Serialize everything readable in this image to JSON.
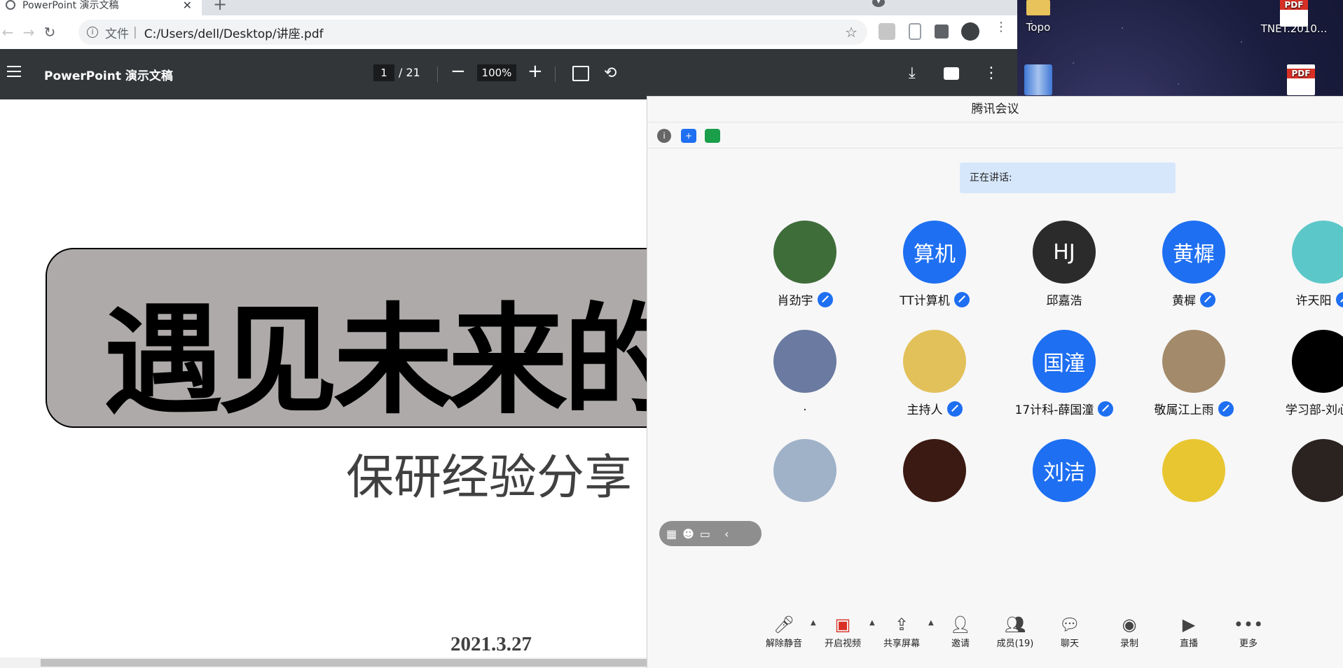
{
  "browser": {
    "tab_title": "PowerPoint 演示文稿",
    "url_label": "文件",
    "url_separator": "|",
    "url": "C:/Users/dell/Desktop/讲座.pdf"
  },
  "pdf_toolbar": {
    "doc_title": "PowerPoint 演示文稿",
    "current_page": "1",
    "total_pages": "/ 21",
    "zoom": "100%"
  },
  "slide": {
    "title": "遇见未来的",
    "subtitle": "保研经验分享",
    "date": "2021.3.27"
  },
  "desktop": {
    "icons": [
      {
        "label": "Topo"
      },
      {
        "label": "TNET.2010...",
        "badge": "PDF"
      },
      {
        "label": "",
        "badge": "PDF"
      }
    ]
  },
  "meeting": {
    "title": "腾讯会议",
    "speaking_label": "正在讲话:",
    "participants": [
      {
        "name": "肖劲宇",
        "avatar_text": "",
        "color": "#3f6d3a",
        "muted": true
      },
      {
        "name": "TT计算机",
        "avatar_text": "算机",
        "color": "#1e6ff1",
        "muted": true
      },
      {
        "name": "邱嘉浩",
        "avatar_text": "HJ",
        "color": "#2b2b2b",
        "muted": false
      },
      {
        "name": "黄樨",
        "avatar_text": "黄樨",
        "color": "#1e6ff1",
        "muted": true
      },
      {
        "name": "许天阳",
        "avatar_text": "",
        "color": "#5cc7c8",
        "muted": true
      },
      {
        "name": ".",
        "avatar_text": "",
        "color": "#6a7aa0",
        "muted": false
      },
      {
        "name": "主持人",
        "avatar_text": "",
        "color": "#e2c15a",
        "muted": true
      },
      {
        "name": "17计科-薛国潼",
        "avatar_text": "国潼",
        "color": "#1e6ff1",
        "muted": true
      },
      {
        "name": "敬属江上雨",
        "avatar_text": "",
        "color": "#a38a6a",
        "muted": true
      },
      {
        "name": "学习部-刘心雨",
        "avatar_text": "",
        "color": "#000000",
        "muted": false
      },
      {
        "name": "",
        "avatar_text": "",
        "color": "#9fb2c8",
        "muted": false
      },
      {
        "name": "",
        "avatar_text": "",
        "color": "#3a1a12",
        "muted": false
      },
      {
        "name": "",
        "avatar_text": "刘洁",
        "color": "#1e6ff1",
        "muted": false
      },
      {
        "name": "",
        "avatar_text": "",
        "color": "#e8c631",
        "muted": false
      },
      {
        "name": "",
        "avatar_text": "",
        "color": "#2a2320",
        "muted": false
      }
    ],
    "toolbar": {
      "unmute": "解除静音",
      "video": "开启视频",
      "share": "共享屏幕",
      "invite": "邀请",
      "members": "成员(19)",
      "chat": "聊天",
      "record": "录制",
      "live": "直播",
      "more": "更多"
    }
  }
}
